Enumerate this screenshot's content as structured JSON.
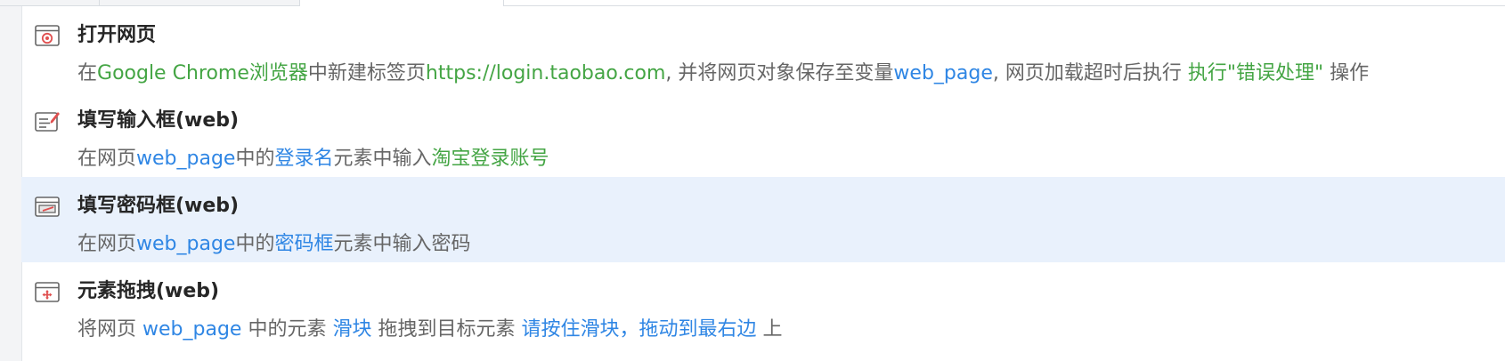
{
  "colors": {
    "link_blue": "#2f86e4",
    "value_green": "#44a544",
    "selected_bg": "#e9f1fc"
  },
  "steps": [
    {
      "icon": "open-webpage-icon",
      "title": "打开网页",
      "desc": {
        "p1": "在",
        "browser": "Google Chrome浏览器",
        "p2": "中新建标签页",
        "url": "https://login.taobao.com",
        "p3": ", 并将网页对象保存至变量",
        "var": "web_page",
        "p4": ", 网页加载超时后执行 ",
        "handler": "执行\"错误处理\"",
        "p5": " 操作"
      }
    },
    {
      "icon": "fill-input-icon",
      "title": "填写输入框(web)",
      "desc": {
        "p1": "在网页",
        "var": "web_page",
        "p2": "中的",
        "element": "登录名",
        "p3": "元素中输入",
        "value": "淘宝登录账号"
      }
    },
    {
      "icon": "fill-password-icon",
      "title": "填写密码框(web)",
      "desc": {
        "p1": "在网页",
        "var": "web_page",
        "p2": "中的",
        "element": "密码框",
        "p3": "元素中输入密码"
      }
    },
    {
      "icon": "drag-element-icon",
      "title": "元素拖拽(web)",
      "desc": {
        "p1": "将网页 ",
        "var": "web_page",
        "p2": " 中的元素 ",
        "element": "滑块",
        "p3": " 拖拽到目标元素 ",
        "target": "请按住滑块，拖动到最右边",
        "p4": " 上"
      }
    }
  ]
}
